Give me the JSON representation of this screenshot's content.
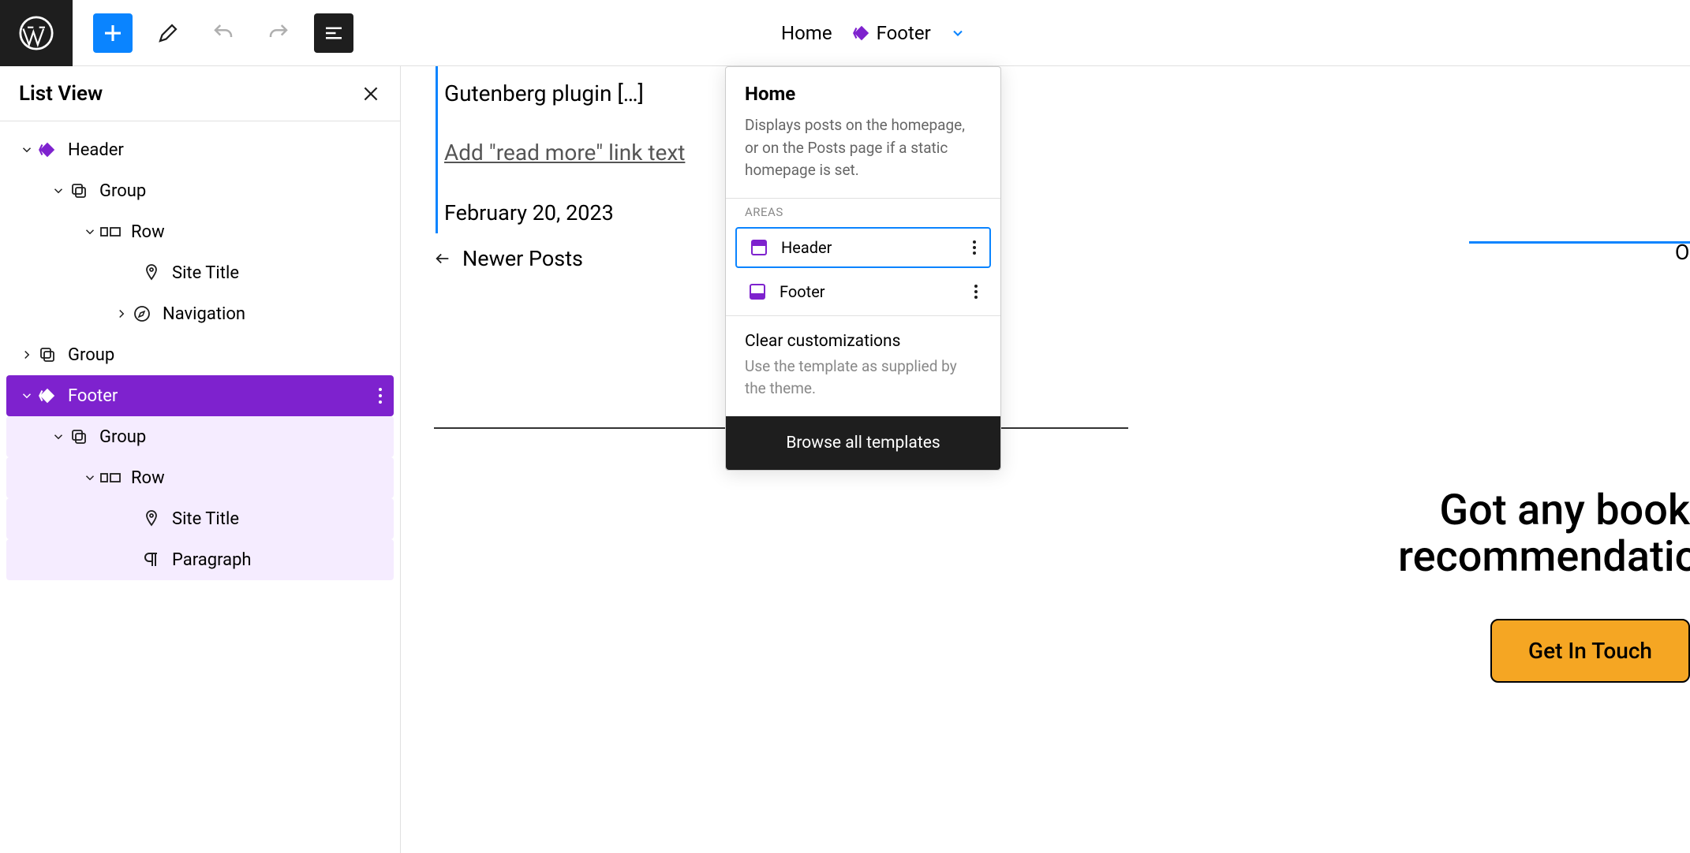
{
  "breadcrumb": {
    "home": "Home",
    "template": "Footer"
  },
  "sidebar": {
    "title": "List View",
    "items": [
      {
        "label": "Header"
      },
      {
        "label": "Group"
      },
      {
        "label": "Row"
      },
      {
        "label": "Site Title"
      },
      {
        "label": "Navigation"
      },
      {
        "label": "Group"
      },
      {
        "label": "Footer"
      },
      {
        "label": "Group"
      },
      {
        "label": "Row"
      },
      {
        "label": "Site Title"
      },
      {
        "label": "Paragraph"
      }
    ]
  },
  "canvas": {
    "post_title": "Gutenberg plugin […]",
    "read_more": "Add \"read more\" link text",
    "date": "February 20, 2023",
    "newer": "Newer Posts",
    "ol": "Ol",
    "cta_line1": "Got any book",
    "cta_line2": "recommendation",
    "cta_button": "Get In Touch"
  },
  "popover": {
    "title": "Home",
    "desc": "Displays posts on the homepage, or on the Posts page if a static homepage is set.",
    "areas_label": "AREAS",
    "areas": [
      {
        "label": "Header"
      },
      {
        "label": "Footer"
      }
    ],
    "clear_title": "Clear customizations",
    "clear_desc": "Use the template as supplied by the theme.",
    "browse": "Browse all templates"
  },
  "colors": {
    "accent": "#7e22ce",
    "blue": "#0a84ff",
    "cta": "#f5a623"
  }
}
